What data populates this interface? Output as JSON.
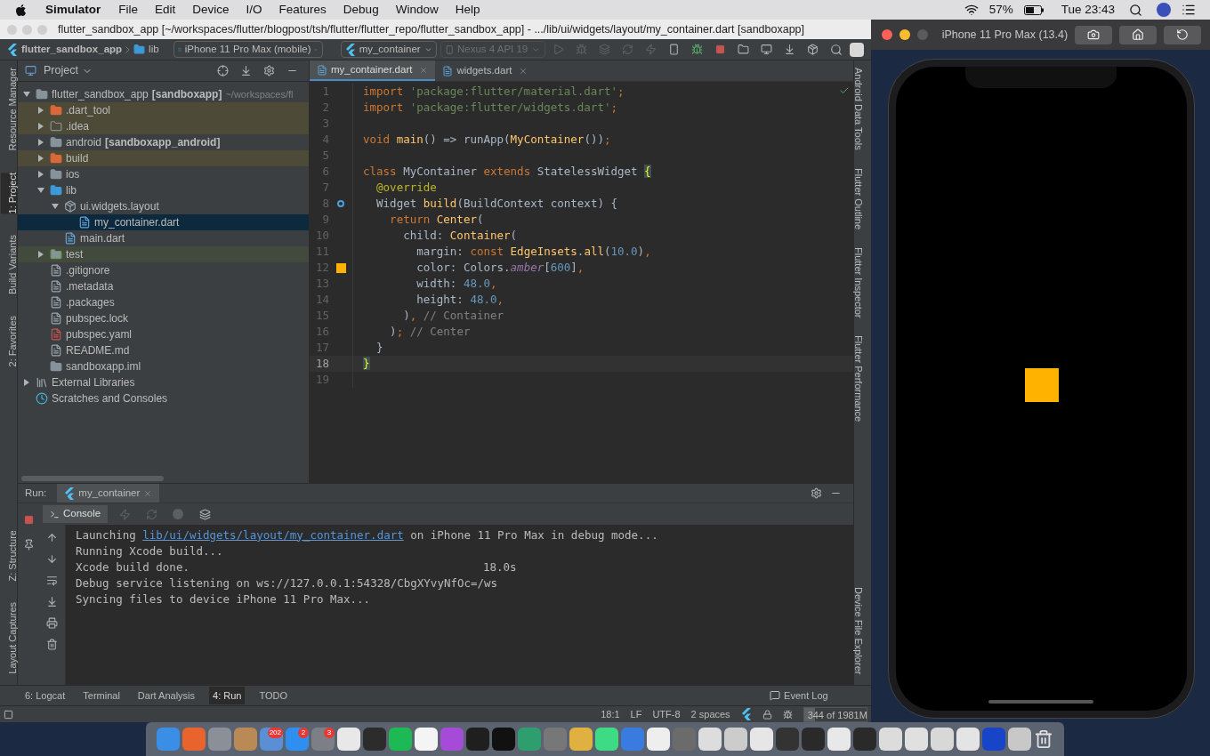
{
  "menubar": {
    "app": "Simulator",
    "menus": [
      "File",
      "Edit",
      "Device",
      "I/O",
      "Features",
      "Debug",
      "Window",
      "Help"
    ],
    "battery": "57%",
    "clock": "Tue 23:43"
  },
  "ide": {
    "title": "flutter_sandbox_app [~/workspaces/flutter/blogpost/tsh/flutter/flutter_repo/flutter_sandbox_app] - .../lib/ui/widgets/layout/my_container.dart [sandboxapp]",
    "breadcrumbs": [
      "flutter_sandbox_app",
      "lib"
    ],
    "device": "iPhone 11 Pro Max (mobile)",
    "run_config": "my_container",
    "emulator": {
      "label": "Nexus 4 API 19",
      "disabled": true
    },
    "left_strip_top": [
      {
        "label": "Resource Manager",
        "selected": false
      },
      {
        "label": "1: Project",
        "selected": true
      },
      {
        "label": "Build Variants",
        "selected": false
      },
      {
        "label": "2: Favorites",
        "selected": false
      }
    ],
    "left_strip_bottom": [
      {
        "label": "Z: Structure",
        "selected": false
      },
      {
        "label": "Layout Captures",
        "selected": false
      }
    ],
    "right_strip_top": [
      "Android Data Tools",
      "Flutter Outline",
      "Flutter Inspector",
      "Flutter Performance"
    ],
    "right_strip_bottom": [
      "Device File Explorer"
    ],
    "project": {
      "title": "Project",
      "tree": [
        {
          "label": "flutter_sandbox_app",
          "tag": "[sandboxapp]",
          "path": "~/workspaces/fl",
          "kind": "module",
          "expanded": true,
          "selected": false,
          "children": [
            {
              "label": ".dart_tool",
              "kind": "folder-excluded",
              "color": "#4d4a38",
              "expanded": false,
              "selected": false
            },
            {
              "label": ".idea",
              "kind": "folder-config",
              "color": "#4d4a38",
              "expanded": false,
              "selected": false
            },
            {
              "label": "android",
              "tag": "[sandboxapp_android]",
              "kind": "module",
              "expanded": false,
              "selected": false
            },
            {
              "label": "build",
              "kind": "folder-excluded",
              "color": "#4d4a38",
              "expanded": false,
              "selected": false
            },
            {
              "label": "ios",
              "kind": "folder",
              "expanded": false,
              "selected": false
            },
            {
              "label": "lib",
              "kind": "folder-source",
              "expanded": true,
              "selected": false,
              "children": [
                {
                  "label": "ui.widgets.layout",
                  "kind": "package",
                  "expanded": true,
                  "selected": false,
                  "children": [
                    {
                      "label": "my_container.dart",
                      "kind": "dart",
                      "selected": true
                    }
                  ]
                },
                {
                  "label": "main.dart",
                  "kind": "dart",
                  "selected": false
                }
              ]
            },
            {
              "label": "test",
              "kind": "folder-test",
              "color": "#414a3c",
              "expanded": false,
              "selected": false
            },
            {
              "label": ".gitignore",
              "kind": "file",
              "selected": false
            },
            {
              "label": ".metadata",
              "kind": "file",
              "selected": false
            },
            {
              "label": ".packages",
              "kind": "file",
              "selected": false
            },
            {
              "label": "pubspec.lock",
              "kind": "file",
              "selected": false
            },
            {
              "label": "pubspec.yaml",
              "kind": "yaml",
              "selected": false
            },
            {
              "label": "README.md",
              "kind": "file",
              "selected": false
            },
            {
              "label": "sandboxapp.iml",
              "kind": "module",
              "selected": false
            }
          ]
        },
        {
          "label": "External Libraries",
          "kind": "libraries",
          "expanded": false,
          "selected": false
        },
        {
          "label": "Scratches and Consoles",
          "kind": "scratches",
          "selected": false
        }
      ]
    },
    "editor": {
      "tabs": [
        {
          "label": "my_container.dart",
          "selected": true
        },
        {
          "label": "widgets.dart",
          "selected": false
        }
      ],
      "lines": [
        {
          "number": "1",
          "current": false,
          "tokens": [
            {
              "kind": "keyword",
              "text": "import"
            },
            {
              "kind": "string",
              "text": " 'package:flutter/material.dart'"
            },
            {
              "kind": "keyword",
              "text": ";"
            }
          ]
        },
        {
          "number": "2",
          "current": false,
          "tokens": [
            {
              "kind": "keyword",
              "text": "import"
            },
            {
              "kind": "string",
              "text": " 'package:flutter/widgets.dart'"
            },
            {
              "kind": "keyword",
              "text": ";"
            }
          ]
        },
        {
          "number": "3",
          "current": false
        },
        {
          "number": "4",
          "current": false,
          "tokens": [
            {
              "kind": "keyword",
              "text": "void"
            },
            {
              "kind": "identifier",
              "text": " main"
            },
            {
              "kind": "plain",
              "text": "() => runApp("
            },
            {
              "kind": "identifier",
              "text": "MyContainer"
            },
            {
              "kind": "plain",
              "text": "())"
            },
            {
              "kind": "keyword",
              "text": ";"
            }
          ]
        },
        {
          "number": "5",
          "current": false
        },
        {
          "number": "6",
          "current": false,
          "tokens": [
            {
              "kind": "keyword",
              "text": "class"
            },
            {
              "kind": "plain",
              "text": " MyContainer "
            },
            {
              "kind": "keyword",
              "text": "extends"
            },
            {
              "kind": "plain",
              "text": " StatelessWidget "
            },
            {
              "kind": "brace",
              "text": "{"
            }
          ]
        },
        {
          "number": "7",
          "current": false,
          "tokens": [
            {
              "kind": "annotation",
              "text": "  @override"
            }
          ]
        },
        {
          "number": "8",
          "current": false,
          "gutter": {
            "kind": "override"
          },
          "tokens": [
            {
              "kind": "plain",
              "text": "  Widget "
            },
            {
              "kind": "identifier",
              "text": "build"
            },
            {
              "kind": "plain",
              "text": "(BuildContext context) {"
            }
          ]
        },
        {
          "number": "9",
          "current": false,
          "tokens": [
            {
              "kind": "keyword",
              "text": "    return"
            },
            {
              "kind": "identifier",
              "text": " Center"
            },
            {
              "kind": "plain",
              "text": "("
            }
          ]
        },
        {
          "number": "10",
          "current": false,
          "tokens": [
            {
              "kind": "plain",
              "text": "      child: "
            },
            {
              "kind": "identifier",
              "text": "Container"
            },
            {
              "kind": "plain",
              "text": "("
            }
          ]
        },
        {
          "number": "11",
          "current": false,
          "tokens": [
            {
              "kind": "plain",
              "text": "        margin: "
            },
            {
              "kind": "keyword",
              "text": "const"
            },
            {
              "kind": "identifier",
              "text": " EdgeInsets"
            },
            {
              "kind": "plain",
              "text": "."
            },
            {
              "kind": "identifier",
              "text": "all"
            },
            {
              "kind": "plain",
              "text": "("
            },
            {
              "kind": "number",
              "text": "10.0"
            },
            {
              "kind": "plain",
              "text": ")"
            },
            {
              "kind": "keyword",
              "text": ","
            }
          ]
        },
        {
          "number": "12",
          "current": false,
          "gutter": {
            "kind": "swatch"
          },
          "tokens": [
            {
              "kind": "plain",
              "text": "        color: Colors."
            },
            {
              "kind": "field",
              "text": "amber"
            },
            {
              "kind": "plain",
              "text": "["
            },
            {
              "kind": "number",
              "text": "600"
            },
            {
              "kind": "plain",
              "text": "]"
            },
            {
              "kind": "keyword",
              "text": ","
            }
          ]
        },
        {
          "number": "13",
          "current": false,
          "tokens": [
            {
              "kind": "plain",
              "text": "        width: "
            },
            {
              "kind": "number",
              "text": "48.0"
            },
            {
              "kind": "keyword",
              "text": ","
            }
          ]
        },
        {
          "number": "14",
          "current": false,
          "tokens": [
            {
              "kind": "plain",
              "text": "        height: "
            },
            {
              "kind": "number",
              "text": "48.0"
            },
            {
              "kind": "keyword",
              "text": ","
            }
          ]
        },
        {
          "number": "15",
          "current": false,
          "tokens": [
            {
              "kind": "plain",
              "text": "      )"
            },
            {
              "kind": "keyword",
              "text": ","
            },
            {
              "kind": "comment",
              "text": " // Container"
            }
          ]
        },
        {
          "number": "16",
          "current": false,
          "tokens": [
            {
              "kind": "plain",
              "text": "    )"
            },
            {
              "kind": "keyword",
              "text": ";"
            },
            {
              "kind": "comment",
              "text": " // Center"
            }
          ]
        },
        {
          "number": "17",
          "current": false,
          "tokens": [
            {
              "kind": "plain",
              "text": "  }"
            }
          ]
        },
        {
          "number": "18",
          "current": true,
          "tokens": [
            {
              "kind": "brace",
              "text": "}"
            }
          ]
        },
        {
          "number": "19",
          "current": false
        }
      ]
    },
    "run": {
      "label": "Run:",
      "tab": "my_container",
      "console_tab": "Console",
      "lines": [
        {
          "parts": [
            {
              "text": "Launching",
              "link": false
            },
            {
              "text": "lib/ui/widgets/layout/my_container.dart",
              "link": true
            },
            {
              "text": "on iPhone 11 Pro Max in debug mode...",
              "link": false
            }
          ]
        },
        {
          "parts": [
            {
              "text": "Running Xcode build...",
              "link": false
            }
          ]
        },
        {
          "parts": [
            {
              "text": "Xcode build done.",
              "link": false
            }
          ],
          "time": "18.0s"
        },
        {
          "parts": [
            {
              "text": "Debug service listening on ws://127.0.0.1:54328/CbgXYvyNfOc=/ws",
              "link": false
            }
          ]
        },
        {
          "parts": [
            {
              "text": "Syncing files to device iPhone 11 Pro Max...",
              "link": false
            }
          ]
        }
      ]
    },
    "tool_windows": [
      {
        "label": "6: Logcat",
        "selected": false
      },
      {
        "label": "Terminal",
        "selected": false
      },
      {
        "label": "Dart Analysis",
        "selected": false
      },
      {
        "label": "4: Run",
        "selected": true
      },
      {
        "label": "TODO",
        "selected": false
      }
    ],
    "event_log": "Event Log",
    "status": {
      "position": "18:1",
      "line_separator": "LF",
      "encoding": "UTF-8",
      "indent": "2 spaces",
      "memory": {
        "text": "344 of 1981M",
        "level": 0.17
      }
    }
  },
  "simulator": {
    "title": "iPhone 11 Pro Max (13.4)"
  },
  "dock": {
    "badges": [
      "202",
      "2",
      "3"
    ]
  }
}
